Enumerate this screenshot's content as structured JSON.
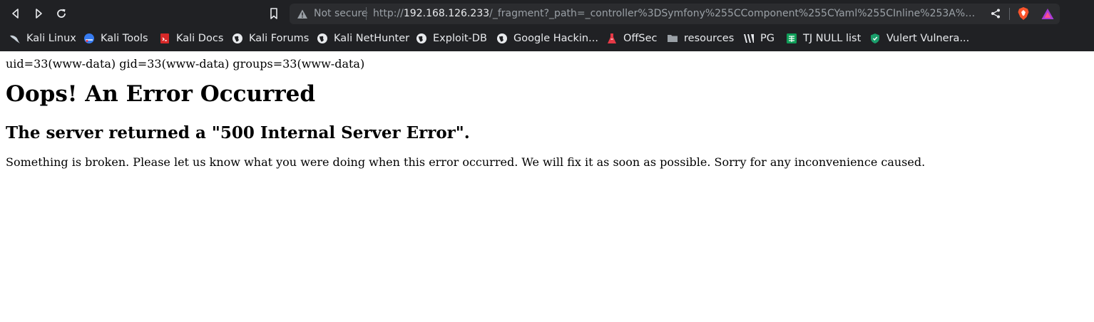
{
  "browser": {
    "security_label": "Not secure",
    "url_scheme": "http://",
    "url_host": "192.168.126.233",
    "url_rest": "/_fragment?_path=_controller%3DSymfony%255CComponent%255CYaml%255CInline%253A%253Aparse%2..."
  },
  "bookmarks": [
    {
      "label": "Kali Linux",
      "icon": "kali-dragon-icon"
    },
    {
      "label": "Kali Tools",
      "icon": "kali-tools-icon"
    },
    {
      "label": "Kali Docs",
      "icon": "kali-docs-icon"
    },
    {
      "label": "Kali Forums",
      "icon": "globe-icon"
    },
    {
      "label": "Kali NetHunter",
      "icon": "globe-icon"
    },
    {
      "label": "Exploit-DB",
      "icon": "globe-icon"
    },
    {
      "label": "Google Hackin...",
      "icon": "globe-icon"
    },
    {
      "label": "OffSec",
      "icon": "offsec-icon"
    },
    {
      "label": "resources",
      "icon": "folder-icon"
    },
    {
      "label": "PG",
      "icon": "pg-icon"
    },
    {
      "label": "TJ NULL list",
      "icon": "sheets-icon"
    },
    {
      "label": "Vulert Vulnera...",
      "icon": "shield-icon"
    }
  ],
  "page": {
    "uid_line": "uid=33(www-data) gid=33(www-data) groups=33(www-data)",
    "heading": "Oops! An Error Occurred",
    "subheading": "The server returned a \"500 Internal Server Error\".",
    "message": "Something is broken. Please let us know what you were doing when this error occurred. We will fix it as soon as possible. Sorry for any inconvenience caused."
  },
  "colors": {
    "chrome_bg": "#202124",
    "urlbar_bg": "#2b2c2f",
    "page_bg": "#ffffff"
  }
}
